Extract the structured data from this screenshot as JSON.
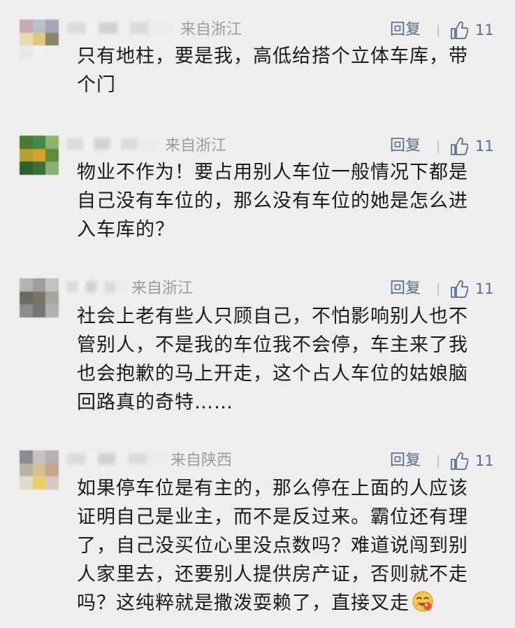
{
  "comments": [
    {
      "location": "来自浙江",
      "reply_label": "回复",
      "likes": "11",
      "lines": [
        "只有地柱，要是我，高低给搭个立体车库，带",
        "个门"
      ],
      "avatar_colors": [
        "#cba9b3",
        "#b8c0cc",
        "#a3a8b6",
        "#e6dcb0",
        "#ddc87e",
        "#8b8565",
        "#e9e9e9",
        "#f0f0f0",
        "#efefef"
      ]
    },
    {
      "location": "来自浙江",
      "reply_label": "回复",
      "likes": "11",
      "lines": [
        "物业不作为！要占用别人车位一般情况下都是",
        "自己没有车位的，那么没有车位的她是怎么进",
        "入车库的？"
      ],
      "avatar_colors": [
        "#4c7a34",
        "#3f8a45",
        "#8fb26c",
        "#b5a02f",
        "#d9a02b",
        "#5c8d3a",
        "#2e5f2b",
        "#3f6e37",
        "#8ab070"
      ]
    },
    {
      "location": "来自浙江",
      "reply_label": "回复",
      "likes": "11",
      "lines": [
        "社会上老有些人只顾自己，不怕影响别人也不",
        "管别人，不是我的车位我不会停，车主来了我",
        "也会抱歉的马上开走，这个占人车位的姑娘脑",
        "回路真的奇特……"
      ],
      "avatar_colors": [
        "#b4b4b4",
        "#9e9e9e",
        "#c2c2c2",
        "#6d6a62",
        "#7a7467",
        "#a9a59c",
        "#8c8c8c",
        "#757575",
        "#b1b1b1"
      ]
    },
    {
      "location": "来自陕西",
      "reply_label": "回复",
      "likes": "11",
      "lines": [
        "如果停车位是有主的，那么停在上面的人应该",
        "证明自己是业主，而不是反过来。霸位还有理",
        "了，自己没买位心里没点数吗？难道说闯到别",
        "人家里去，还要别人提供房产证，否则就不走",
        "吗？这纯粹就是撒泼耍赖了，直接叉走"
      ],
      "avatar_colors": [
        "#8f8a8f",
        "#c9c3c6",
        "#b5b0b3",
        "#b9b3a4",
        "#d0c195",
        "#c7a48c",
        "#e0dccb",
        "#e8d25f",
        "#d9c8c0"
      ]
    }
  ],
  "icons": {
    "like": "thumbs-up-icon",
    "emoji": "laughing-emoji-icon"
  }
}
